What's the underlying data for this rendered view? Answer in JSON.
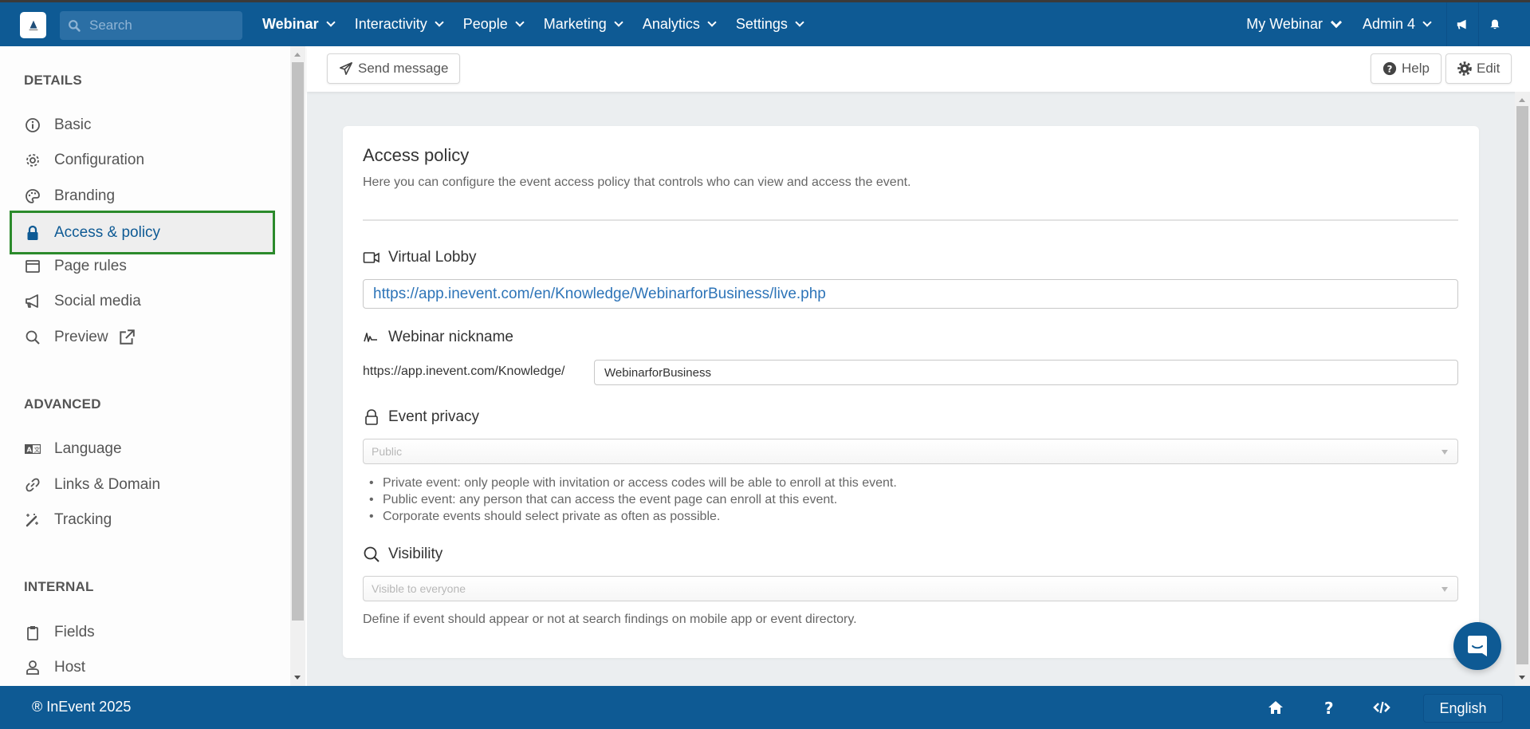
{
  "topbar": {
    "search_placeholder": "Search",
    "nav": [
      {
        "label": "Webinar"
      },
      {
        "label": "Interactivity"
      },
      {
        "label": "People"
      },
      {
        "label": "Marketing"
      },
      {
        "label": "Analytics"
      },
      {
        "label": "Settings"
      }
    ],
    "event_selector": "My Webinar",
    "user_menu": "Admin 4"
  },
  "sidebar": {
    "sections": [
      {
        "title": "DETAILS"
      },
      {
        "title": "ADVANCED"
      },
      {
        "title": "INTERNAL"
      }
    ],
    "details_items": [
      {
        "label": "Basic",
        "icon": "info-circle-icon"
      },
      {
        "label": "Configuration",
        "icon": "gear-icon"
      },
      {
        "label": "Branding",
        "icon": "palette-icon"
      },
      {
        "label": "Access & policy",
        "icon": "lock-icon",
        "active": true
      },
      {
        "label": "Page rules",
        "icon": "window-icon"
      },
      {
        "label": "Social media",
        "icon": "megaphone-icon"
      },
      {
        "label": "Preview",
        "icon": "search-icon"
      }
    ],
    "advanced_items": [
      {
        "label": "Language",
        "icon": "language-icon"
      },
      {
        "label": "Links & Domain",
        "icon": "link-icon"
      },
      {
        "label": "Tracking",
        "icon": "magic-wand-icon"
      }
    ],
    "internal_items": [
      {
        "label": "Fields",
        "icon": "clipboard-icon"
      },
      {
        "label": "Host",
        "icon": "user-icon"
      }
    ]
  },
  "toolbar": {
    "send_message": "Send message",
    "help": "Help",
    "edit": "Edit"
  },
  "card": {
    "title": "Access policy",
    "description": "Here you can configure the event access policy that controls who can view and access the event.",
    "virtual_lobby": {
      "label": "Virtual Lobby",
      "value": "https://app.inevent.com/en/Knowledge/WebinarforBusiness/live.php"
    },
    "nickname": {
      "label": "Webinar nickname",
      "prefix": "https://app.inevent.com/Knowledge/",
      "value": "WebinarforBusiness"
    },
    "privacy": {
      "label": "Event privacy",
      "selected": "Public",
      "notes": [
        "Private event: only people with invitation or access codes will be able to enroll at this event.",
        "Public event: any person that can access the event page can enroll at this event.",
        "Corporate events should select private as often as possible."
      ]
    },
    "visibility": {
      "label": "Visibility",
      "selected": "Visible to everyone",
      "help": "Define if event should appear or not at search findings on mobile app or event directory."
    }
  },
  "footer": {
    "copyright": "® InEvent 2025",
    "language": "English"
  },
  "colors": {
    "brand": "#0e5a94",
    "active_outline": "#2b8a2b",
    "link": "#2d74b8"
  }
}
